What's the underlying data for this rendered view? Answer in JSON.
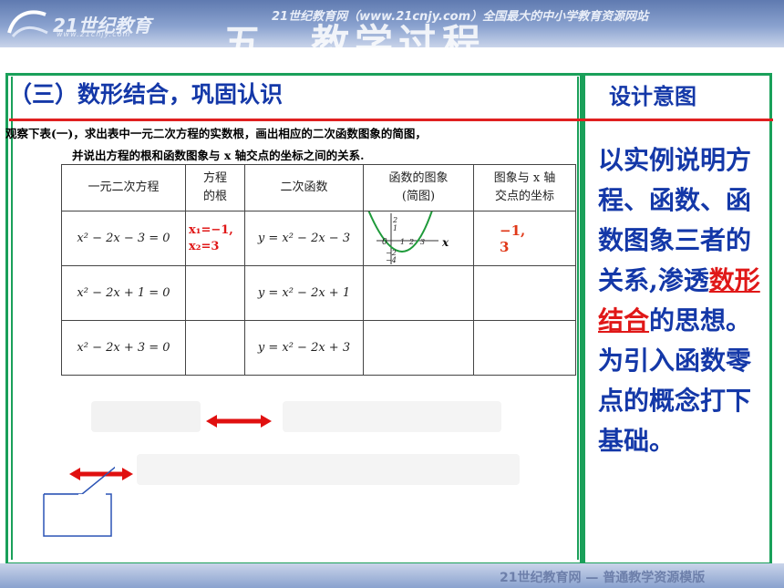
{
  "header": {
    "logo_text": "21世纪教育",
    "logo_url": "www.21cnjy.com",
    "site_slogan": "21世纪教育网（www.21cnjy.com）全国最大的中小学教育资源网站",
    "big_title": "五、教学过程"
  },
  "section": {
    "title": "（三）数形结合，巩固认识"
  },
  "side": {
    "title": "设计意图",
    "text_part1": "以实例说明方程、函数、函数图象三者的关系,渗透",
    "text_highlight": "数形结合",
    "text_part2": "的思想。为引入函数零点的概念打下基础。"
  },
  "instructions": {
    "line1": "观察下表(一)，求出表中一元二次方程的实数根，画出相应的二次函数图象的简图，",
    "line2": "并说出方程的根和函数图象与 x 轴交点的坐标之间的关系."
  },
  "table": {
    "headers": [
      "一元二次方程",
      "方程的根",
      "二次函数",
      "函数的图象(简图)",
      "图象与x轴交点的坐标"
    ],
    "header_lines": [
      [
        "一元二次方程"
      ],
      [
        "方程",
        "的根"
      ],
      [
        "二次函数"
      ],
      [
        "函数的图象",
        "(简图)"
      ],
      [
        "图象与 x 轴",
        "交点的坐标"
      ]
    ],
    "rows": [
      {
        "equation": "x² − 2x − 3 = 0",
        "roots_line1": "x₁=−1,",
        "roots_line2": "x₂=3",
        "function": "y = x² − 2x − 3",
        "intersections_line1": "−1,",
        "intersections_line2": "3"
      },
      {
        "equation": "x² − 2x + 1 = 0",
        "roots_line1": "",
        "roots_line2": "",
        "function": "y = x² − 2x + 1",
        "intersections_line1": "",
        "intersections_line2": ""
      },
      {
        "equation": "x² − 2x + 3 = 0",
        "roots_line1": "",
        "roots_line2": "",
        "function": "y = x² − 2x + 3",
        "intersections_line1": "",
        "intersections_line2": ""
      }
    ],
    "graph_labels": {
      "y_axis": "y",
      "x_axis": "x",
      "origin": "0",
      "ticks_y": [
        "2",
        "1",
        "−1",
        "−2",
        "−3",
        "−4"
      ],
      "ticks_x": [
        "−1",
        "1",
        "2",
        "3"
      ]
    }
  },
  "colors": {
    "title_blue": "#1438a8",
    "frame_green": "#1aa05a",
    "accent_red": "#e02020",
    "arrow_red": "#e01010"
  }
}
